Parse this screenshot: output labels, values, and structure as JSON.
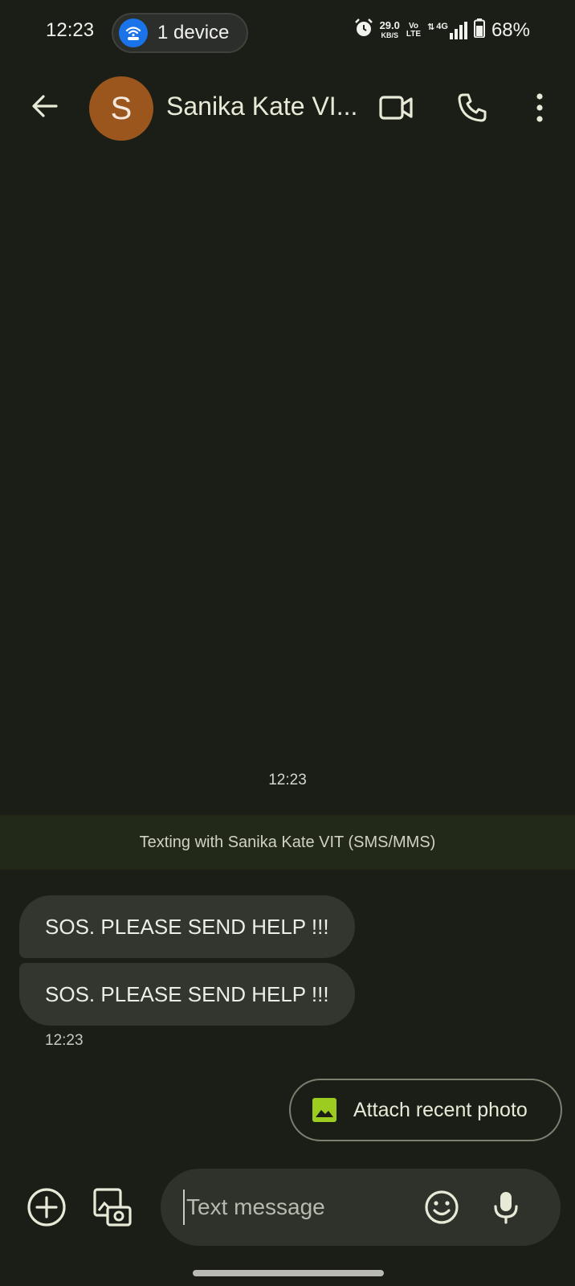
{
  "status_bar": {
    "time": "12:23",
    "hotspot_label": "1 device",
    "net_speed_value": "29.0",
    "net_speed_unit": "KB/S",
    "volte_top": "Vo",
    "volte_bottom": "LTE",
    "network": "4G",
    "battery": "68%"
  },
  "app_bar": {
    "avatar_letter": "S",
    "avatar_color": "#9b561d",
    "contact_name": "Sanika Kate VI..."
  },
  "conversation": {
    "timestamp": "12:23",
    "banner": "Texting with Sanika Kate VIT (SMS/MMS)",
    "messages": [
      {
        "text": "SOS. PLEASE SEND HELP !!!"
      },
      {
        "text": "SOS. PLEASE SEND HELP !!!"
      }
    ],
    "message_time": "12:23"
  },
  "suggestion": {
    "label": "Attach recent photo",
    "icon_color": "#9ccc20"
  },
  "compose": {
    "placeholder": "Text message"
  }
}
